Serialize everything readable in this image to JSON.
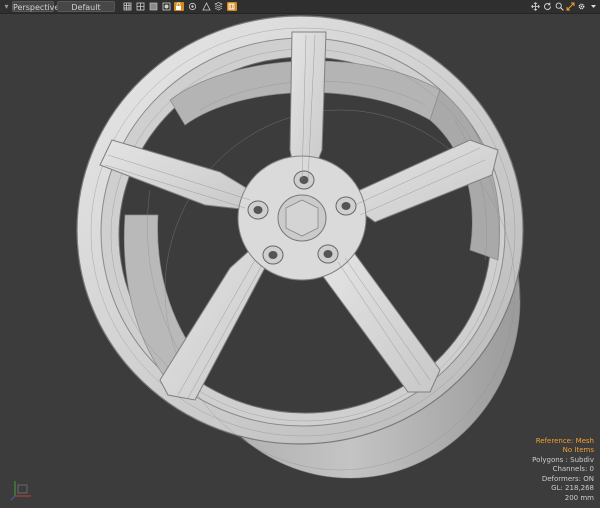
{
  "toolbar": {
    "view_mode": "Perspective",
    "shading_mode": "Default",
    "left_icons": [
      "grid-icon",
      "wireframe-icon",
      "visibility-icon",
      "texture-icon",
      "lock-icon",
      "ao-icon",
      "camera-icon",
      "layers-icon"
    ],
    "right_icons": [
      "move-icon",
      "rotate-icon",
      "zoom-icon",
      "fit-icon",
      "settings-icon",
      "menu-icon"
    ]
  },
  "info": {
    "reference": "Reference: Mesh",
    "items": "No Items",
    "polygons": "Polygons : Subdiv",
    "channels": "Channels: 0",
    "deformers": "Deformers: ON",
    "gl": "GL: 218,268",
    "scale": "200 mm"
  },
  "colors": {
    "background": "#3c3c3c",
    "toolbar": "#2f2f2f",
    "accent": "#f0a030",
    "wheel": "#d6d6d6"
  }
}
